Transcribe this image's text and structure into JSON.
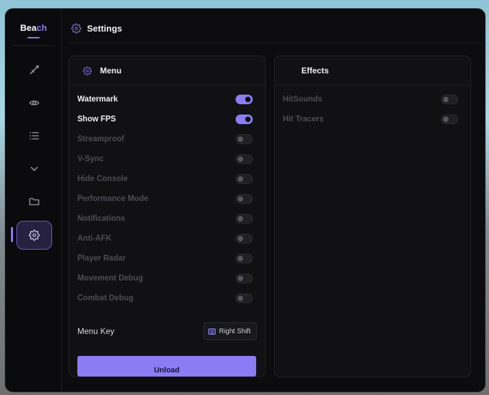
{
  "app": {
    "logo_prefix": "Bea",
    "logo_accent": "ch",
    "accent_color": "#8b7cf6"
  },
  "header": {
    "title": "Settings",
    "icon": "gear-icon"
  },
  "sidebar": {
    "items": [
      {
        "name": "combat",
        "icon": "sword-icon",
        "active": false
      },
      {
        "name": "visuals",
        "icon": "eye-icon",
        "active": false
      },
      {
        "name": "list",
        "icon": "list-icon",
        "active": false
      },
      {
        "name": "more",
        "icon": "chevron-down-icon",
        "active": false
      },
      {
        "name": "configs",
        "icon": "folder-icon",
        "active": false
      },
      {
        "name": "settings",
        "icon": "gear-icon",
        "active": true
      }
    ]
  },
  "menu_panel": {
    "title": "Menu",
    "options": [
      {
        "label": "Watermark",
        "on": true
      },
      {
        "label": "Show FPS",
        "on": true
      },
      {
        "label": "Streamproof",
        "on": false
      },
      {
        "label": "V-Sync",
        "on": false
      },
      {
        "label": "Hide Console",
        "on": false
      },
      {
        "label": "Performance Mode",
        "on": false
      },
      {
        "label": "Notifications",
        "on": false
      },
      {
        "label": "Anti-AFK",
        "on": false
      },
      {
        "label": "Player Radar",
        "on": false
      },
      {
        "label": "Movement Debug",
        "on": false
      },
      {
        "label": "Combat Debug",
        "on": false
      }
    ],
    "menu_key_label": "Menu Key",
    "menu_key_value": "Right Shift",
    "unload_label": "Unload"
  },
  "effects_panel": {
    "title": "Effects",
    "options": [
      {
        "label": "HitSounds",
        "on": false
      },
      {
        "label": "Hit Tracers",
        "on": false
      }
    ]
  }
}
